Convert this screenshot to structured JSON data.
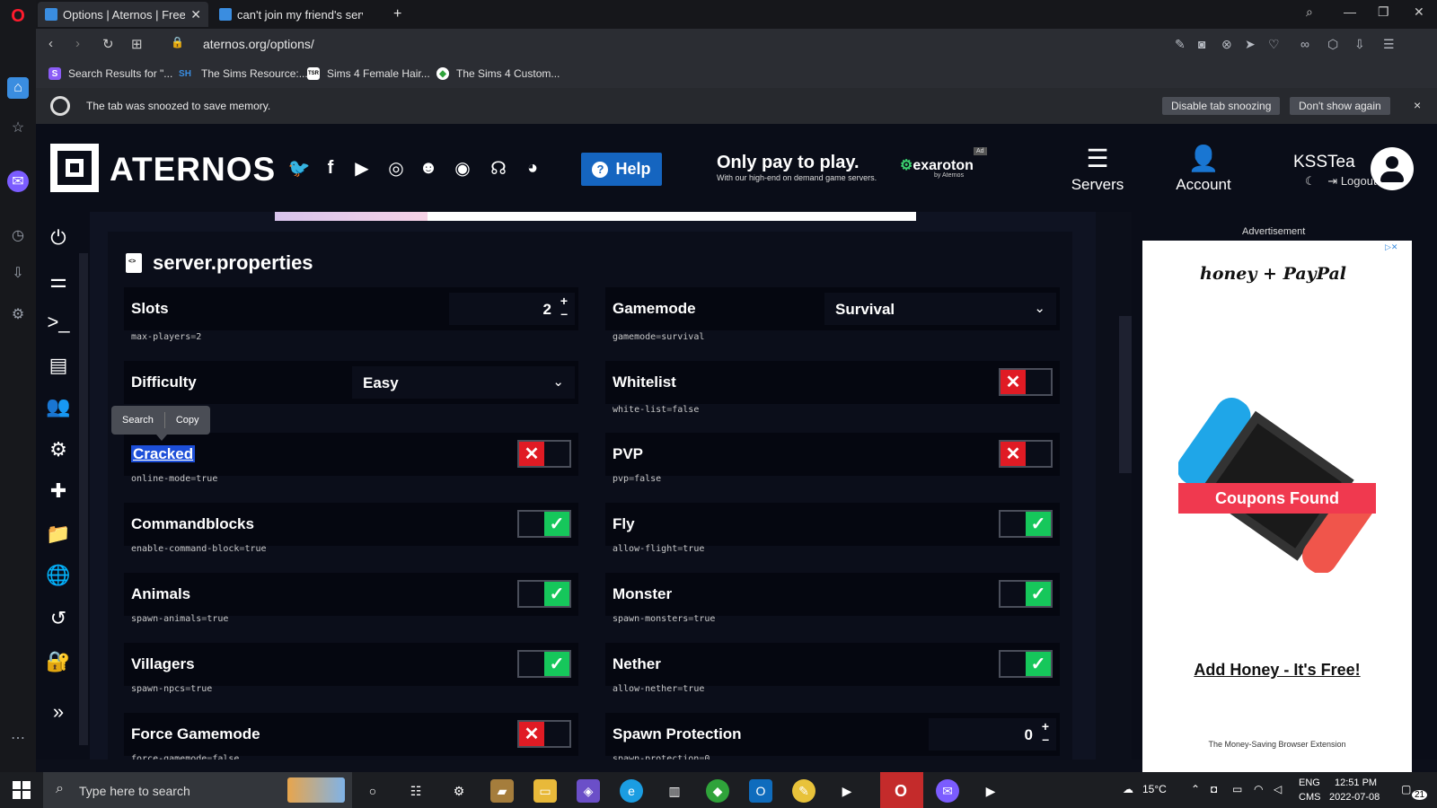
{
  "browser": {
    "tabs": [
      {
        "title": "Options | Aternos | Free Mi",
        "active": true
      },
      {
        "title": "can't join my friend's serve",
        "active": false
      }
    ],
    "new_tab": "+",
    "url": "aternos.org/options/",
    "bookmarks": [
      {
        "label": "Search Results for \"...",
        "icon": "S"
      },
      {
        "label": "The Sims Resource:...",
        "icon": "SH"
      },
      {
        "label": "Sims 4 Female Hair...",
        "icon": "TSR"
      },
      {
        "label": "The Sims 4 Custom...",
        "icon": "leaf"
      }
    ],
    "snooze": {
      "message": "The tab was snoozed to save memory.",
      "btn_disable": "Disable tab snoozing",
      "btn_dont_show": "Don't show again",
      "close": "×"
    }
  },
  "header": {
    "logo_text": "ATERNOS",
    "help_label": "Help",
    "ad_headline": "Only pay to play.",
    "ad_subline": "With our high-end on demand game servers.",
    "ad_brand": "exaroton",
    "ad_brand_sub": "by Aternos",
    "ad_badge": "Ad",
    "nav_servers": "Servers",
    "nav_account": "Account",
    "username": "KSSTea",
    "logout": "Logout"
  },
  "page": {
    "section_title": "server.properties",
    "context_menu": {
      "search": "Search",
      "copy": "Copy"
    },
    "properties": [
      {
        "label": "Slots",
        "key": "max-players",
        "value": "2",
        "type": "number"
      },
      {
        "label": "Gamemode",
        "key": "gamemode",
        "value": "survival",
        "display": "Survival",
        "type": "select"
      },
      {
        "label": "Difficulty",
        "key": "difficulty",
        "value": "easy",
        "display": "Easy",
        "type": "select"
      },
      {
        "label": "Whitelist",
        "key": "white-list",
        "value": "false",
        "type": "toggle",
        "on": false
      },
      {
        "label": "Cracked",
        "key": "online-mode",
        "value": "true",
        "type": "toggle",
        "on": false
      },
      {
        "label": "PVP",
        "key": "pvp",
        "value": "false",
        "type": "toggle",
        "on": false
      },
      {
        "label": "Commandblocks",
        "key": "enable-command-block",
        "value": "true",
        "type": "toggle",
        "on": true
      },
      {
        "label": "Fly",
        "key": "allow-flight",
        "value": "true",
        "type": "toggle",
        "on": true
      },
      {
        "label": "Animals",
        "key": "spawn-animals",
        "value": "true",
        "type": "toggle",
        "on": true
      },
      {
        "label": "Monster",
        "key": "spawn-monsters",
        "value": "true",
        "type": "toggle",
        "on": true
      },
      {
        "label": "Villagers",
        "key": "spawn-npcs",
        "value": "true",
        "type": "toggle",
        "on": true
      },
      {
        "label": "Nether",
        "key": "allow-nether",
        "value": "true",
        "type": "toggle",
        "on": true
      },
      {
        "label": "Force Gamemode",
        "key": "force-gamemode",
        "value": "false",
        "type": "toggle",
        "on": false
      },
      {
        "label": "Spawn Protection",
        "key": "spawn-protection",
        "value": "0",
        "type": "number"
      }
    ]
  },
  "advert": {
    "label": "Advertisement",
    "brand": "honey + PayPal",
    "coupons": "Coupons Found",
    "cta": "Add Honey - It's Free!",
    "sub": "The Money-Saving Browser Extension"
  },
  "taskbar": {
    "search_placeholder": "Type here to search",
    "weather": "15°C",
    "lang1": "ENG",
    "lang2": "CMS",
    "time": "12:51 PM",
    "date": "2022-07-08",
    "notifications": "21"
  },
  "colors": {
    "accent_blue": "#1565c0",
    "toggle_on": "#16c75b",
    "toggle_off": "#e01b24",
    "coupons_red": "#f0394f"
  }
}
